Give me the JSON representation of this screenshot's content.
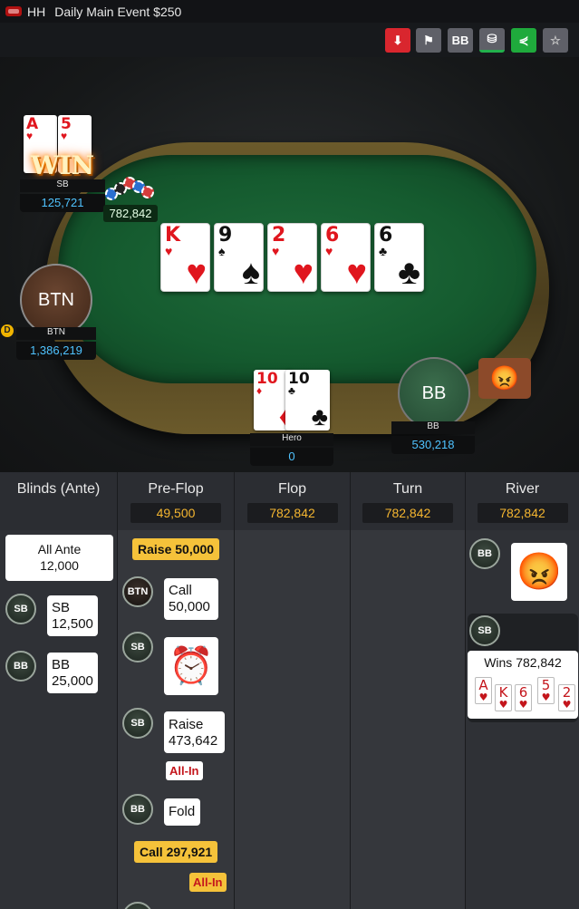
{
  "title": {
    "prefix": "HH",
    "event": "Daily Main Event $250"
  },
  "toolbar": {
    "bb_label": "BB",
    "star": "☆",
    "share": "⋞",
    "spy": "⛁",
    "flag": "⚑",
    "download": "⬇"
  },
  "seats": {
    "sb": {
      "name": "SB",
      "stack": "125,721",
      "cards": [
        {
          "rank": "A",
          "suit": "♥"
        },
        {
          "rank": "5",
          "suit": "♥"
        }
      ],
      "badge": "WIN"
    },
    "btn": {
      "avatar": "BTN",
      "name": "BTN",
      "stack": "1,386,219",
      "dealer": "D"
    },
    "hero": {
      "name": "Hero",
      "stack": "0",
      "cards": [
        {
          "rank": "10",
          "suit": "♦"
        },
        {
          "rank": "10",
          "suit": "♣"
        }
      ]
    },
    "bb": {
      "avatar": "BB",
      "name": "BB",
      "stack": "530,218"
    }
  },
  "pot": "782,842",
  "board": [
    {
      "rank": "K",
      "suit": "♥",
      "color": "#e0161e"
    },
    {
      "rank": "9",
      "suit": "♠",
      "color": "#111111"
    },
    {
      "rank": "2",
      "suit": "♥",
      "color": "#e0161e"
    },
    {
      "rank": "6",
      "suit": "♥",
      "color": "#e0161e"
    },
    {
      "rank": "6",
      "suit": "♣",
      "color": "#111111"
    }
  ],
  "streets": [
    {
      "name": "Blinds (Ante)",
      "pot": ""
    },
    {
      "name": "Pre-Flop",
      "pot": "49,500"
    },
    {
      "name": "Flop",
      "pot": "782,842"
    },
    {
      "name": "Turn",
      "pot": "782,842"
    },
    {
      "name": "River",
      "pot": "782,842"
    }
  ],
  "blinds": {
    "ante_l1": "All Ante",
    "ante_l2": "12,000",
    "sb_chip": "SB",
    "sb_l1": "SB",
    "sb_l2": "12,500",
    "bb_chip": "BB",
    "bb_l1": "BB",
    "bb_l2": "25,000"
  },
  "preflop": {
    "raise1": "Raise 50,000",
    "btn_chip": "BTN",
    "call_l1": "Call",
    "call_l2": "50,000",
    "sb_chip1": "SB",
    "sb_chip2": "SB",
    "raise2_l1": "Raise",
    "raise2_l2": "473,642",
    "allin1": "All-In",
    "bb_chip": "BB",
    "fold": "Fold",
    "call2": "Call 297,921",
    "allin2": "All-In"
  },
  "river": {
    "bb_chip": "BB",
    "sb_chip": "SB",
    "wins": "Wins 782,842",
    "cards": [
      {
        "rank": "A",
        "suit": "♥"
      },
      {
        "rank": "K",
        "suit": "♥"
      },
      {
        "rank": "6",
        "suit": "♥"
      },
      {
        "rank": "5",
        "suit": "♥"
      },
      {
        "rank": "2",
        "suit": "♥"
      }
    ]
  }
}
